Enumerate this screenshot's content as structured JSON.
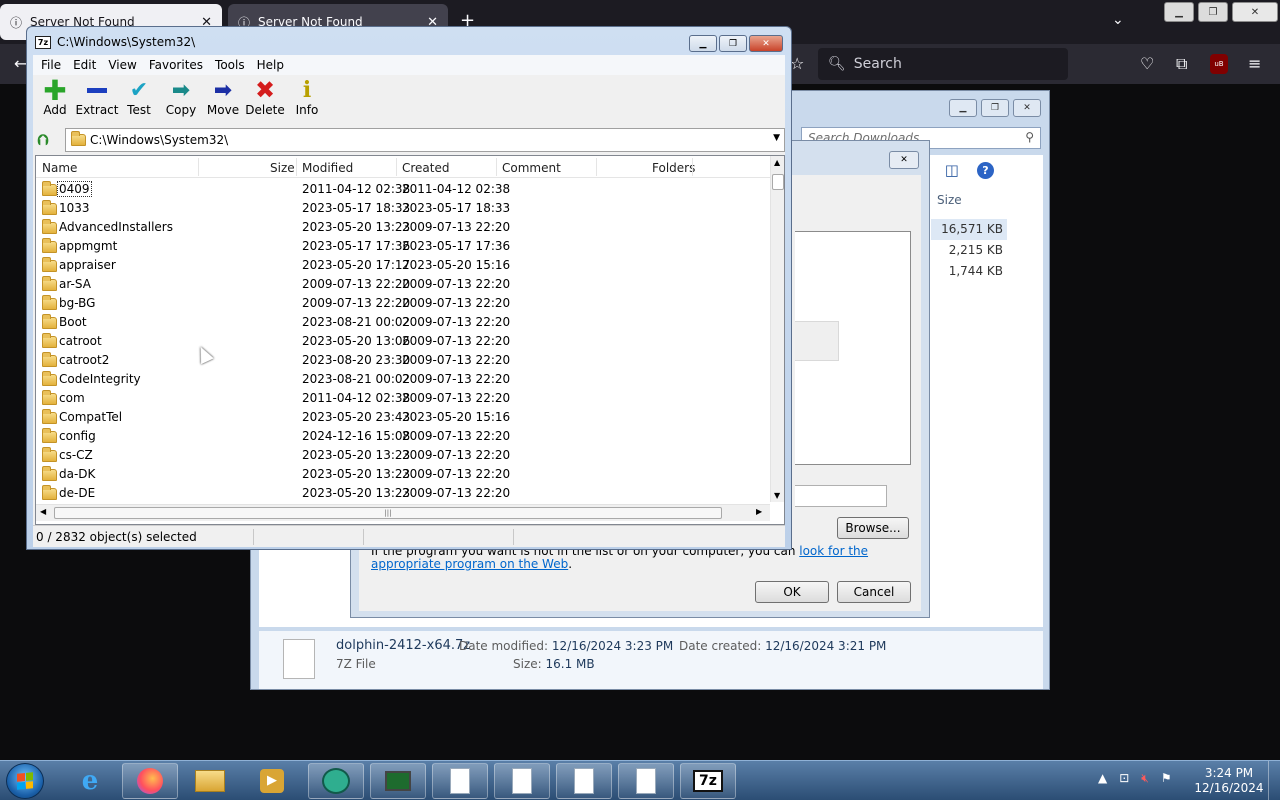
{
  "firefox": {
    "tabs": [
      {
        "label": "Server Not Found"
      },
      {
        "label": "Server Not Found"
      }
    ],
    "search_placeholder": "Search",
    "ublock_label": "uB"
  },
  "explorer": {
    "search_placeholder": "Search Downloads",
    "size_header": "Size",
    "sizes": [
      "16,571 KB",
      "2,215 KB",
      "1,744 KB"
    ],
    "details": {
      "file_name": "dolphin-2412-x64.7z",
      "file_type": "7Z File",
      "date_modified_label": "Date modified:",
      "date_modified": "12/16/2024 3:23 PM",
      "date_created_label": "Date created:",
      "date_created": "12/16/2024 3:21 PM",
      "size_label": "Size:",
      "size": "16.1 MB"
    }
  },
  "open_with": {
    "browse_label": "Browse...",
    "hint_text": "If the program you want is not in the list or on your computer, you can",
    "hint_link": "look for the appropriate program on the Web",
    "hint_end": ".",
    "ok_label": "OK",
    "cancel_label": "Cancel"
  },
  "sevenzip": {
    "logo": "7z",
    "title": "C:\\Windows\\System32\\",
    "menu": [
      "File",
      "Edit",
      "View",
      "Favorites",
      "Tools",
      "Help"
    ],
    "toolbar": [
      {
        "label": "Add",
        "icon": "plus-icon",
        "color": "#2aa52a"
      },
      {
        "label": "Extract",
        "icon": "minus-icon",
        "color": "#1c3fbf"
      },
      {
        "label": "Test",
        "icon": "check-icon",
        "color": "#1ca3c4"
      },
      {
        "label": "Copy",
        "icon": "double-arrow-icon",
        "color": "#1a8a8a"
      },
      {
        "label": "Move",
        "icon": "arrow-right-icon",
        "color": "#1c2fa5"
      },
      {
        "label": "Delete",
        "icon": "x-icon",
        "color": "#d41c1c"
      },
      {
        "label": "Info",
        "icon": "info-icon",
        "color": "#b8a000"
      }
    ],
    "address": "C:\\Windows\\System32\\",
    "columns": {
      "name": "Name",
      "size": "Size",
      "modified": "Modified",
      "created": "Created",
      "comment": "Comment",
      "folders": "Folders"
    },
    "rows": [
      {
        "name": "0409",
        "modified": "2011-04-12 02:38",
        "created": "2011-04-12 02:38"
      },
      {
        "name": "1033",
        "modified": "2023-05-17 18:33",
        "created": "2023-05-17 18:33"
      },
      {
        "name": "AdvancedInstallers",
        "modified": "2023-05-20 13:23",
        "created": "2009-07-13 22:20"
      },
      {
        "name": "appmgmt",
        "modified": "2023-05-17 17:36",
        "created": "2023-05-17 17:36"
      },
      {
        "name": "appraiser",
        "modified": "2023-05-20 17:17",
        "created": "2023-05-20 15:16"
      },
      {
        "name": "ar-SA",
        "modified": "2009-07-13 22:20",
        "created": "2009-07-13 22:20"
      },
      {
        "name": "bg-BG",
        "modified": "2009-07-13 22:20",
        "created": "2009-07-13 22:20"
      },
      {
        "name": "Boot",
        "modified": "2023-08-21 00:02",
        "created": "2009-07-13 22:20"
      },
      {
        "name": "catroot",
        "modified": "2023-05-20 13:06",
        "created": "2009-07-13 22:20"
      },
      {
        "name": "catroot2",
        "modified": "2023-08-20 23:30",
        "created": "2009-07-13 22:20"
      },
      {
        "name": "CodeIntegrity",
        "modified": "2023-08-21 00:02",
        "created": "2009-07-13 22:20"
      },
      {
        "name": "com",
        "modified": "2011-04-12 02:38",
        "created": "2009-07-13 22:20"
      },
      {
        "name": "CompatTel",
        "modified": "2023-05-20 23:43",
        "created": "2023-05-20 15:16"
      },
      {
        "name": "config",
        "modified": "2024-12-16 15:08",
        "created": "2009-07-13 22:20"
      },
      {
        "name": "cs-CZ",
        "modified": "2023-05-20 13:23",
        "created": "2009-07-13 22:20"
      },
      {
        "name": "da-DK",
        "modified": "2023-05-20 13:23",
        "created": "2009-07-13 22:20"
      },
      {
        "name": "de-DE",
        "modified": "2023-05-20 13:23",
        "created": "2009-07-13 22:20"
      }
    ],
    "status": "0 / 2832 object(s) selected"
  },
  "taskbar": {
    "clock_time": "3:24 PM",
    "clock_date": "12/16/2024",
    "sevenzip_label": "7z"
  }
}
